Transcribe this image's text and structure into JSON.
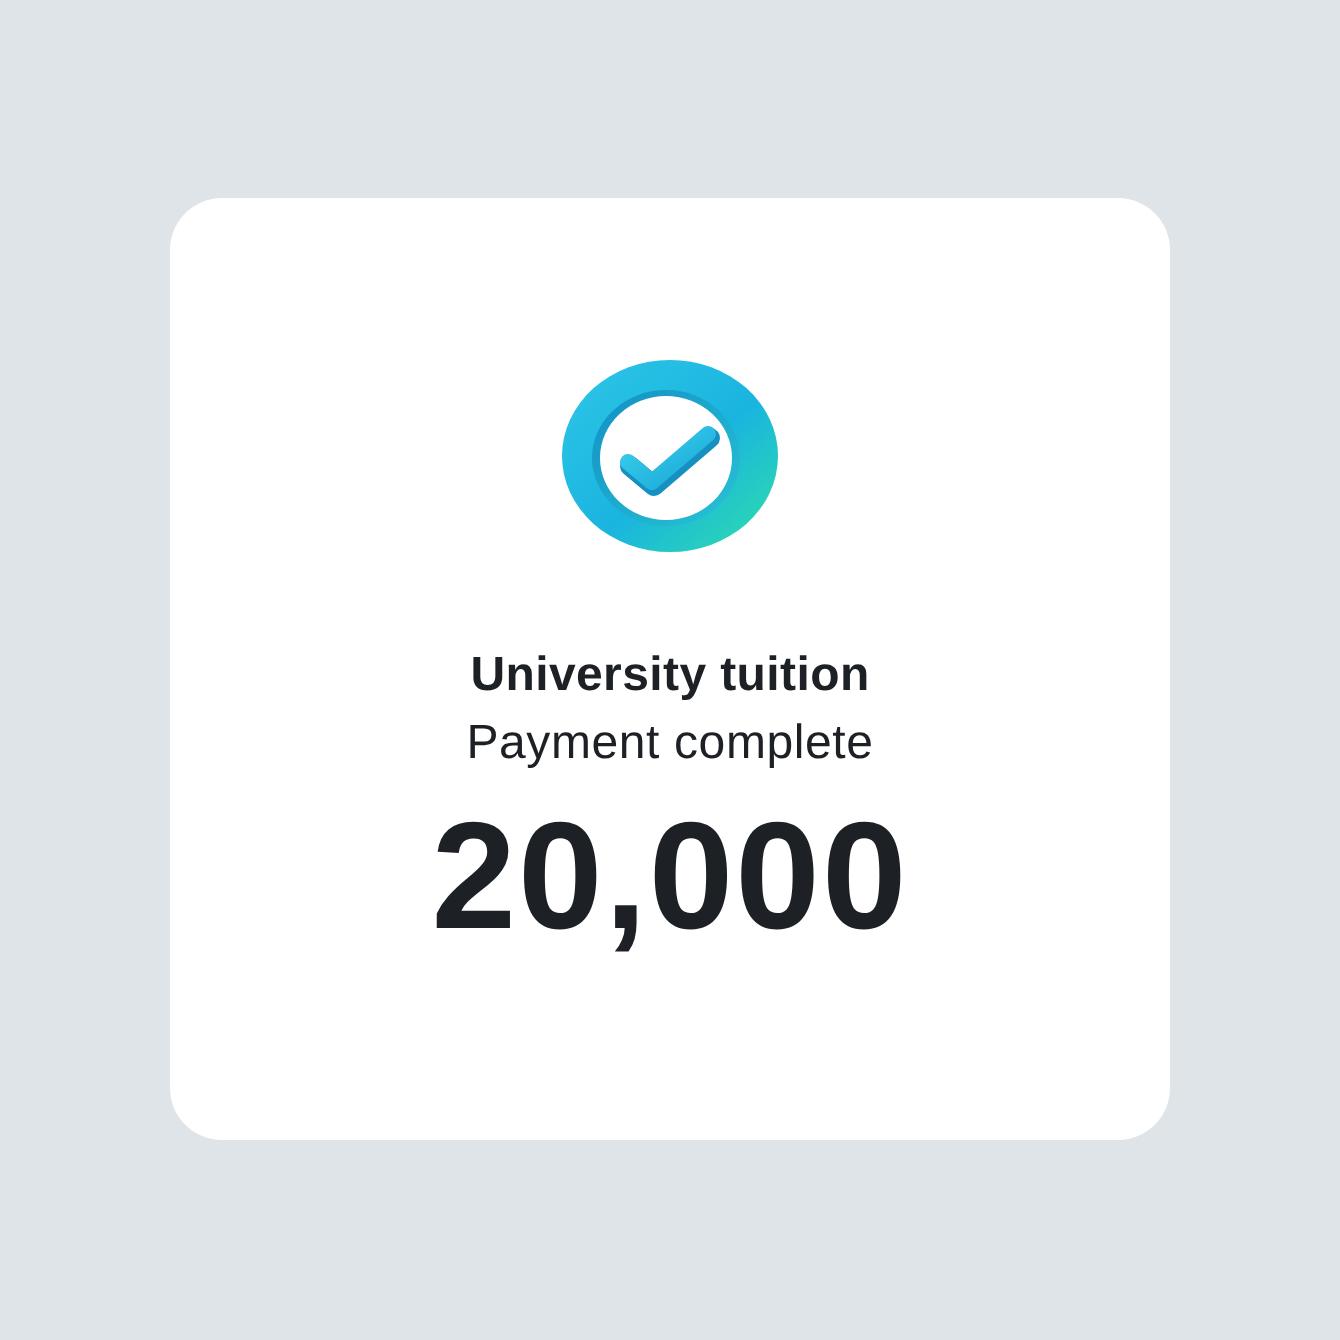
{
  "card": {
    "title": "University tuition",
    "status": "Payment complete",
    "amount": "20,000"
  }
}
